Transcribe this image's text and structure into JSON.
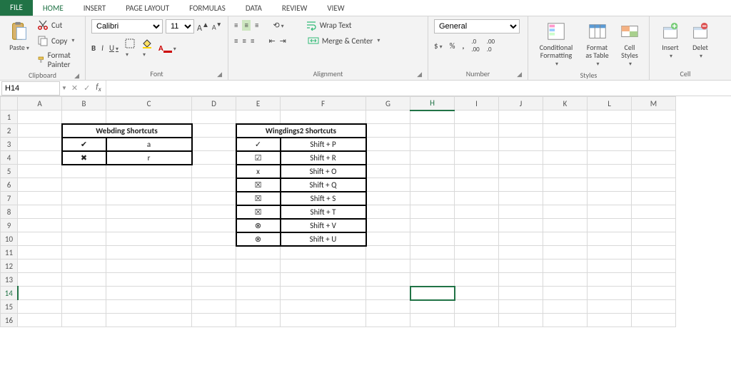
{
  "tabs": {
    "file": "FILE",
    "items": [
      "HOME",
      "INSERT",
      "PAGE LAYOUT",
      "FORMULAS",
      "DATA",
      "REVIEW",
      "VIEW"
    ],
    "active": "HOME"
  },
  "clipboard": {
    "paste": "Paste",
    "cut": "Cut",
    "copy": "Copy",
    "format_painter": "Format Painter",
    "title": "Clipboard"
  },
  "font": {
    "name": "Calibri",
    "size": "11",
    "title": "Font"
  },
  "alignment": {
    "wrap": "Wrap Text",
    "merge": "Merge & Center",
    "title": "Alignment"
  },
  "number": {
    "format": "General",
    "title": "Number"
  },
  "styles": {
    "cond": "Conditional Formatting",
    "table": "Format as Table",
    "cell": "Cell Styles",
    "title": "Styles"
  },
  "cells": {
    "insert": "Insert",
    "delete": "Delet",
    "title": "Cell"
  },
  "namebox": "H14",
  "columns": [
    "A",
    "B",
    "C",
    "D",
    "E",
    "F",
    "G",
    "H",
    "I",
    "J",
    "K",
    "L",
    "M"
  ],
  "active_col": "H",
  "active_row": 14,
  "webding": {
    "title": "Webding Shortcuts",
    "rows": [
      {
        "sym": "✔",
        "key": "a"
      },
      {
        "sym": "✖",
        "key": "r"
      }
    ]
  },
  "wingdings2": {
    "title": "Wingdings2 Shortcuts",
    "rows": [
      {
        "sym": "✓",
        "key": "Shift + P"
      },
      {
        "sym": "☑",
        "key": "Shift + R"
      },
      {
        "sym": "x",
        "key": "Shift + O"
      },
      {
        "sym": "☒",
        "key": "Shift + Q"
      },
      {
        "sym": "☒",
        "key": "Shift + S"
      },
      {
        "sym": "☒",
        "key": "Shift + T"
      },
      {
        "sym": "⊗",
        "key": "Shift + V"
      },
      {
        "sym": "⊗",
        "key": "Shift + U"
      }
    ]
  }
}
